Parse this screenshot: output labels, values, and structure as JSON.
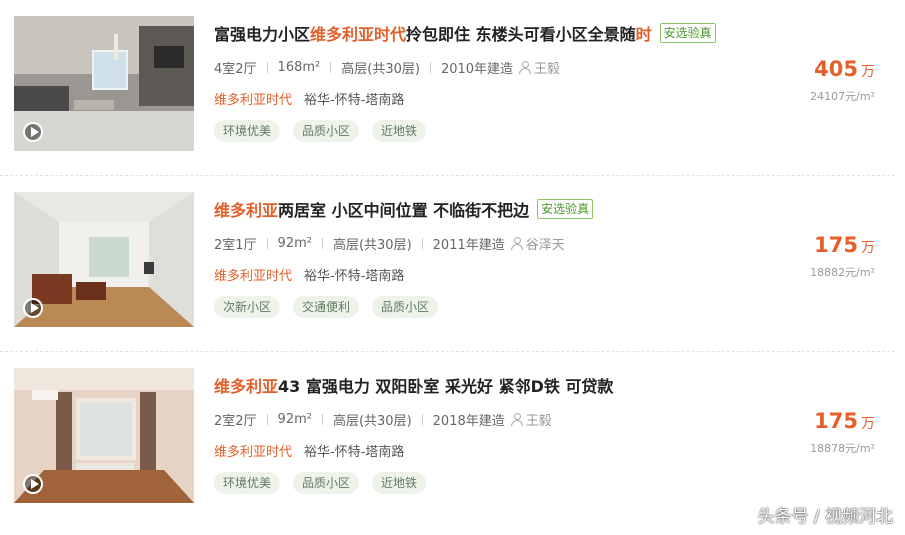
{
  "listings": [
    {
      "title_parts": [
        "富强电力小区 ",
        "维多利亚时代",
        " 拎包即住 东楼头可看小区全景随",
        "时"
      ],
      "badge": "安选验真",
      "info": [
        "4室2厅",
        "168m²",
        "高层(共30层)",
        "2010年建造"
      ],
      "agent": "王毅",
      "community": "维多利亚时代",
      "area": "裕华-怀特-塔南路",
      "tags": [
        "环境优美",
        "品质小区",
        "近地铁"
      ],
      "price_total": "405",
      "price_unit_label": "万",
      "unit_price": "24107元/m²",
      "photo": "living-room-photo"
    },
    {
      "title_parts": [
        "维多利亚",
        "两居室 小区中间位置 不临街不把边",
        "",
        ""
      ],
      "badge": "安选验真",
      "info": [
        "2室1厅",
        "92m²",
        "高层(共30层)",
        "2011年建造"
      ],
      "agent": "谷泽天",
      "community": "维多利亚时代",
      "area": "裕华-怀特-塔南路",
      "tags": [
        "次新小区",
        "交通便利",
        "品质小区"
      ],
      "price_total": "175",
      "price_unit_label": "万",
      "unit_price": "18882元/m²",
      "photo": "living-room-photo"
    },
    {
      "title_parts": [
        "维多利亚",
        " 43 富强电力 双阳卧室 采光好 紧邻D铁 可贷款",
        "",
        ""
      ],
      "badge": "",
      "info": [
        "2室2厅",
        "92m²",
        "高层(共30层)",
        "2018年建造"
      ],
      "agent": "王毅",
      "community": "维多利亚时代",
      "area": "裕华-怀特-塔南路",
      "tags": [
        "环境优美",
        "品质小区",
        "近地铁"
      ],
      "price_total": "175",
      "price_unit_label": "万",
      "unit_price": "18878元/m²",
      "photo": "bedroom-photo"
    }
  ],
  "watermark": "头条号 / 视频河北",
  "colors": {
    "accent": "#e4602a",
    "verify": "#4b9a29",
    "tag_bg": "#eef3ea"
  }
}
